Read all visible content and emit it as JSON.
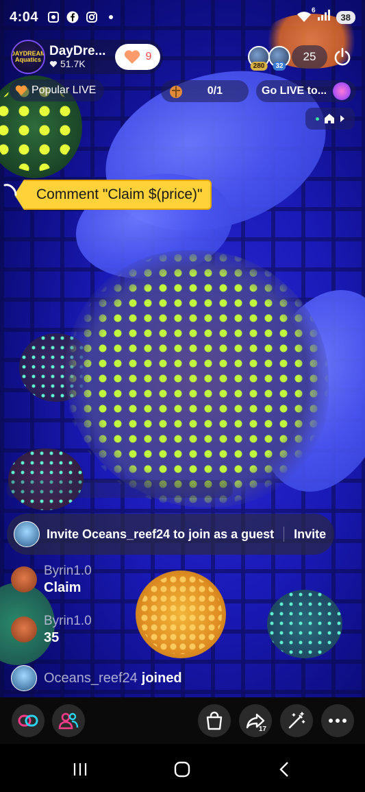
{
  "status_bar": {
    "time": "4:04",
    "battery": "38",
    "signal_label": "6",
    "notification_icons": [
      "screen-capture-icon",
      "facebook-icon",
      "instagram-icon",
      "dot-icon"
    ]
  },
  "host": {
    "name": "DayDre...",
    "likes": "51.7K",
    "avatar_logo_text": "DAYDREAM Aquatics",
    "follow_count": "9"
  },
  "viewers": {
    "top_badges": [
      "280",
      "32"
    ],
    "count": "25"
  },
  "tags": {
    "popular_live": "Popular LIVE",
    "gift_goal": "0/1",
    "go_live": "Go LIVE to..."
  },
  "comment_prompt": "Comment \"Claim $(price)\"",
  "invite": {
    "text": "Invite Oceans_reef24 to join as a guest",
    "button": "Invite"
  },
  "chat": [
    {
      "user": "Byrin1.0",
      "text": "Claim"
    },
    {
      "user": "Byrin1.0",
      "text": "35"
    }
  ],
  "join": {
    "user": "Oceans_reef24",
    "text": "joined"
  },
  "bottom_bar": {
    "share_count": "17"
  },
  "colors": {
    "tag_yellow": "#ffd23a",
    "follow_heart": "#ff8a5c",
    "accent_pink": "#ff3b8a",
    "accent_cyan": "#2ad4f0",
    "coral_green": "#c8ff3a"
  }
}
